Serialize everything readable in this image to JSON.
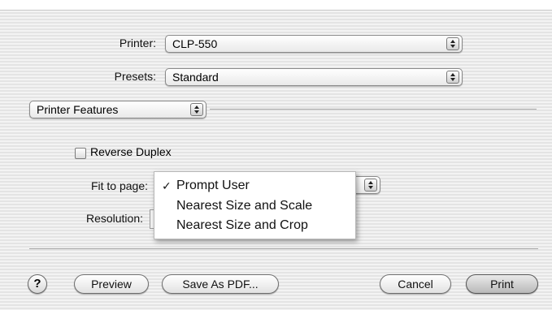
{
  "form": {
    "printer_label": "Printer:",
    "printer_value": "CLP-550",
    "presets_label": "Presets:",
    "presets_value": "Standard",
    "section_value": "Printer Features"
  },
  "features": {
    "reverse_duplex_label": "Reverse Duplex",
    "reverse_duplex_checked": false,
    "fit_to_page_label": "Fit to page:",
    "resolution_label": "Resolution:"
  },
  "fit_menu": {
    "items": [
      {
        "label": "Prompt User",
        "checked": true
      },
      {
        "label": "Nearest Size and Scale",
        "checked": false
      },
      {
        "label": "Nearest Size and Crop",
        "checked": false
      }
    ],
    "check_glyph": "✓"
  },
  "buttons": {
    "help": "?",
    "preview": "Preview",
    "save_pdf": "Save As PDF...",
    "cancel": "Cancel",
    "print": "Print"
  }
}
